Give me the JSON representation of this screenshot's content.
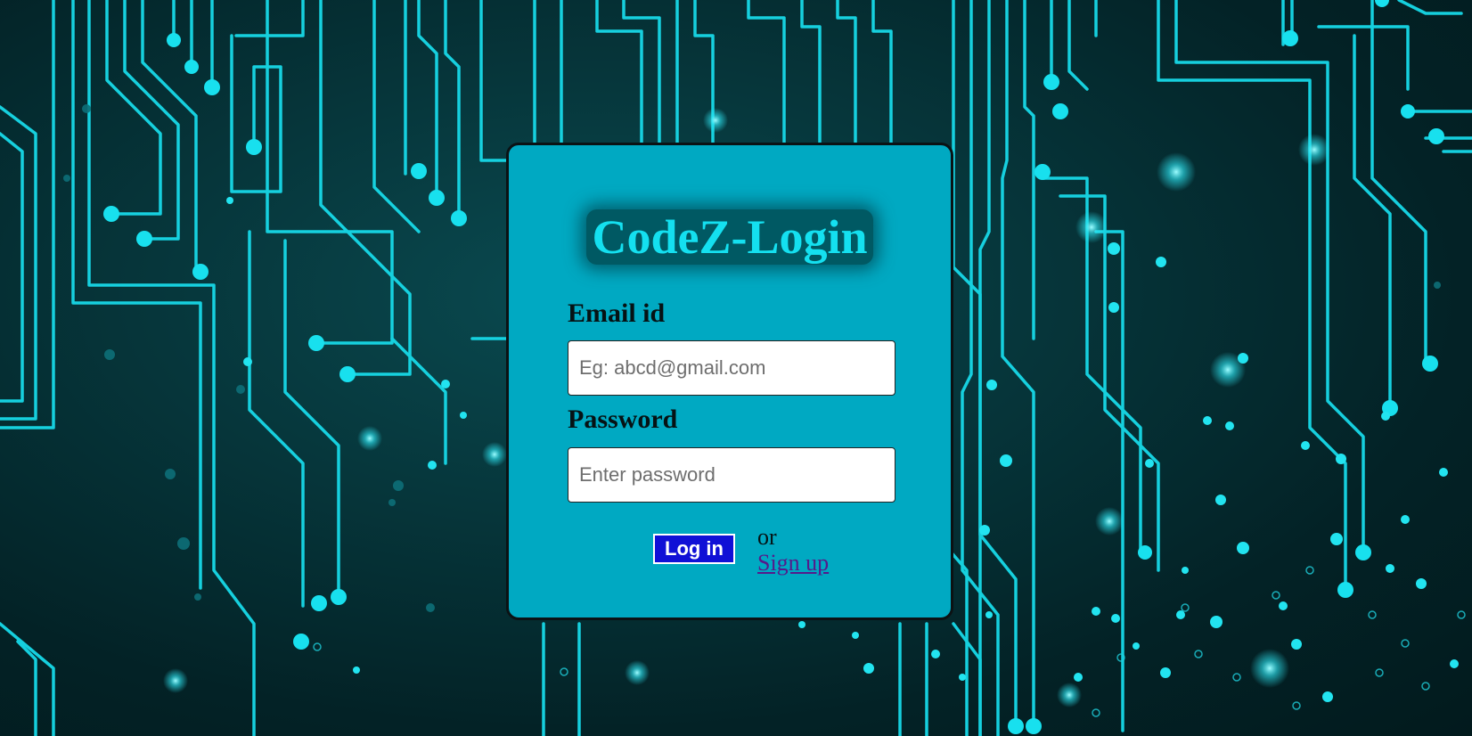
{
  "login": {
    "title": "CodeZ-Login",
    "email_label": "Email id",
    "email_placeholder": "Eg: abcd@gmail.com",
    "email_value": "",
    "password_label": "Password",
    "password_placeholder": "Enter password",
    "password_value": "",
    "login_button": "Log in",
    "or_text": "or",
    "signup_link": "Sign up"
  },
  "colors": {
    "card": "#00a9c2",
    "title_bg": "#005963",
    "title_text": "#14e0f0",
    "button": "#1010d6",
    "link": "#551a8b",
    "circuit": "#14d8e6"
  },
  "background": {
    "description_icon": "circuit-board-icon"
  }
}
